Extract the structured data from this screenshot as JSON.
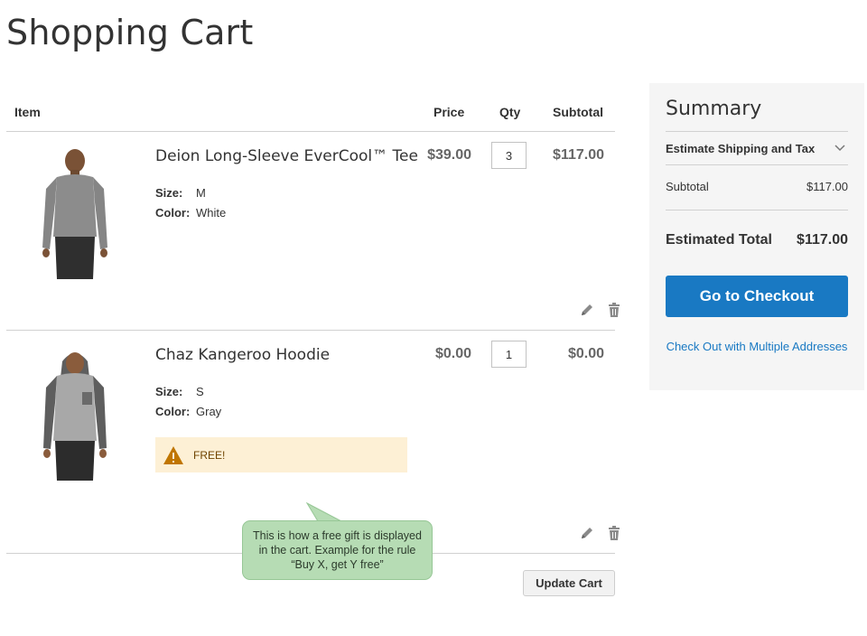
{
  "page": {
    "title": "Shopping Cart"
  },
  "cart": {
    "headers": {
      "item": "Item",
      "price": "Price",
      "qty": "Qty",
      "subtotal": "Subtotal"
    },
    "items": [
      {
        "name": "Deion Long-Sleeve EverCool™ Tee",
        "options": [
          {
            "label": "Size:",
            "value": "M"
          },
          {
            "label": "Color:",
            "value": "White"
          }
        ],
        "price": "$39.00",
        "qty": "3",
        "subtotal": "$117.00",
        "image_icon": "gray-long-sleeve-tee-image"
      },
      {
        "name": "Chaz Kangeroo Hoodie",
        "options": [
          {
            "label": "Size:",
            "value": "S"
          },
          {
            "label": "Color:",
            "value": "Gray"
          }
        ],
        "price": "$0.00",
        "qty": "1",
        "subtotal": "$0.00",
        "notice": "FREE!",
        "image_icon": "gray-hoodie-image"
      }
    ],
    "update_button": "Update Cart"
  },
  "callout": {
    "lines": [
      "This is how a free gift is displayed",
      "in the cart. Example for the rule",
      "“Buy X, get Y free”"
    ]
  },
  "summary": {
    "title": "Summary",
    "estimate_shipping": "Estimate Shipping and Tax",
    "subtotal_label": "Subtotal",
    "subtotal_value": "$117.00",
    "estimated_total_label": "Estimated Total",
    "estimated_total_value": "$117.00",
    "checkout_button": "Go to Checkout",
    "multi_address_link": "Check Out with Multiple Addresses"
  },
  "colors": {
    "primary_button": "#1979c3",
    "notice_background": "#fdf0d5",
    "callout_background": "#b6dcb4",
    "summary_background": "#f5f5f5"
  }
}
